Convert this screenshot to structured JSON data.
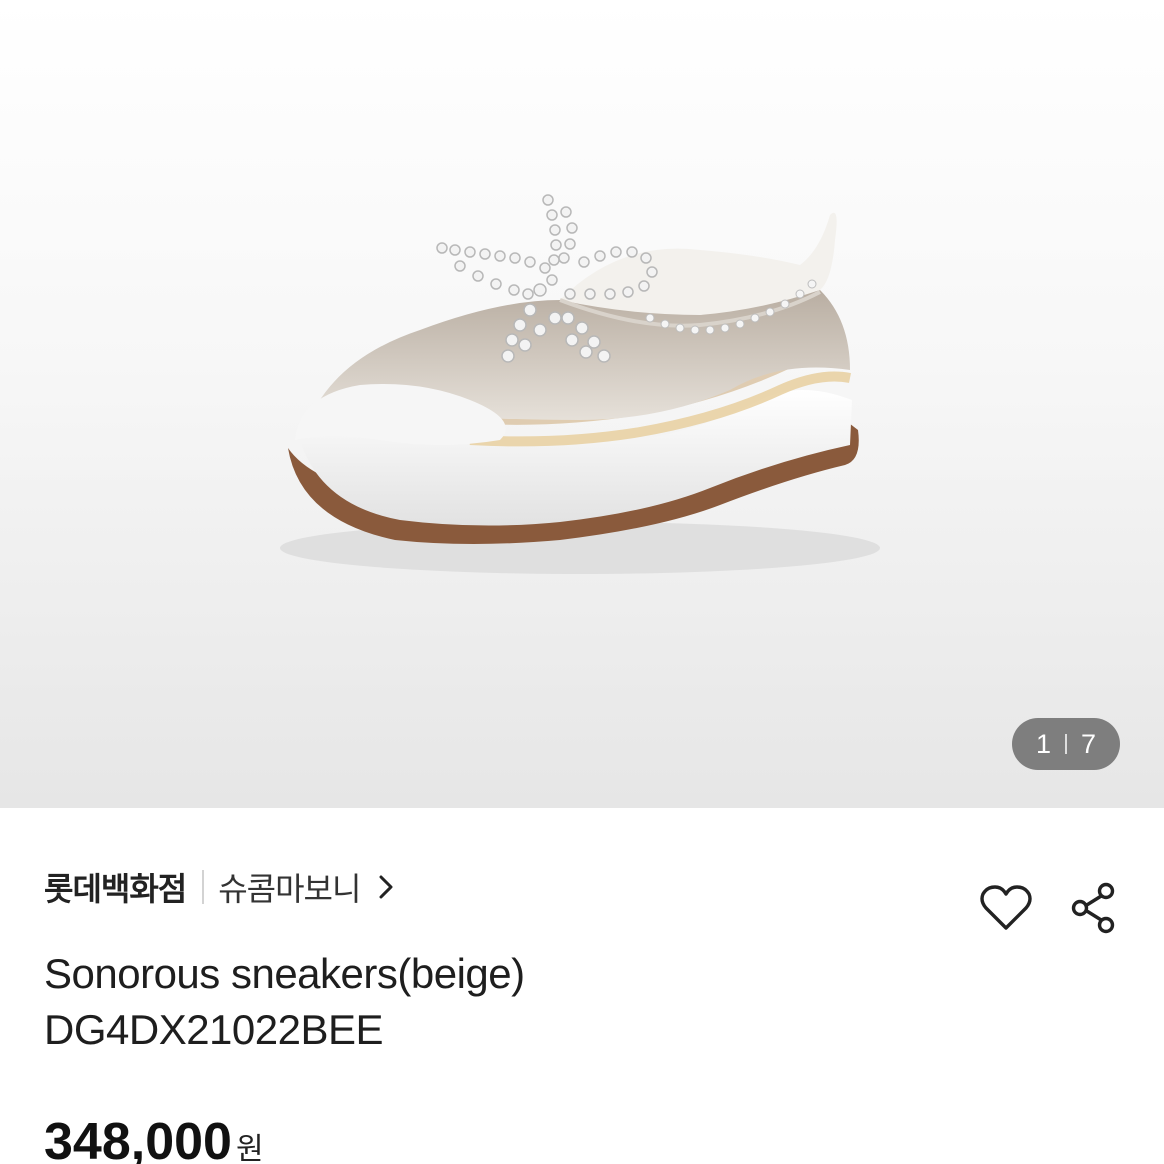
{
  "gallery": {
    "image_alt": "product-image",
    "current": "1",
    "total": "7"
  },
  "seller": {
    "store": "롯데백화점",
    "brand": "슈콤마보니"
  },
  "product": {
    "name": "Sonorous sneakers(beige)",
    "code": "DG4DX21022BEE",
    "price": "348,000",
    "currency": "원"
  },
  "icons": {
    "brand_link": "chevron-right-icon",
    "like": "heart-icon",
    "share": "share-icon"
  },
  "colors": {
    "counter_bg": "#6e6e6e",
    "text": "#1e1e1e"
  }
}
